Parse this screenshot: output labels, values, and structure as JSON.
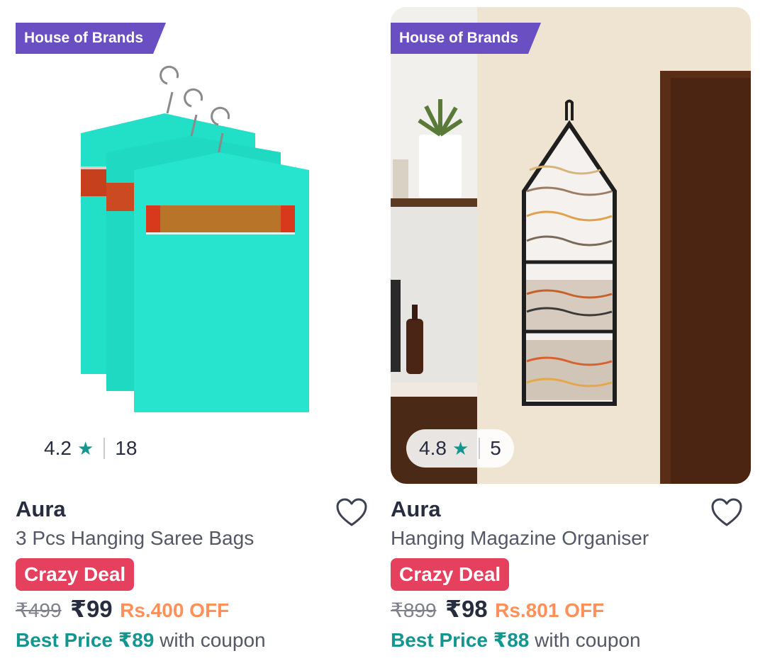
{
  "products": [
    {
      "badge": "House of Brands",
      "rating": "4.2",
      "rating_star": "★",
      "rating_count": "18",
      "brand": "Aura",
      "title": "3 Pcs Hanging Saree Bags",
      "deal": "Crazy Deal",
      "mrp": "₹499",
      "price": "₹99",
      "discount": "Rs.400 OFF",
      "best_price": "Best Price ₹89",
      "coupon_text": "with coupon"
    },
    {
      "badge": "House of Brands",
      "rating": "4.8",
      "rating_star": "★",
      "rating_count": "5",
      "brand": "Aura",
      "title": "Hanging Magazine Organiser",
      "deal": "Crazy Deal",
      "mrp": "₹899",
      "price": "₹98",
      "discount": "Rs.801 OFF",
      "best_price": "Best Price ₹88",
      "coupon_text": "with coupon"
    }
  ],
  "colors": {
    "badge": "#6a4fc3",
    "deal": "#e6405f",
    "discount": "#ff905a",
    "best_price": "#14958f",
    "text_dark": "#282c3f",
    "text_muted": "#535766"
  },
  "icons": [
    "star-icon",
    "heart-outline-icon",
    "hanger-icon"
  ]
}
